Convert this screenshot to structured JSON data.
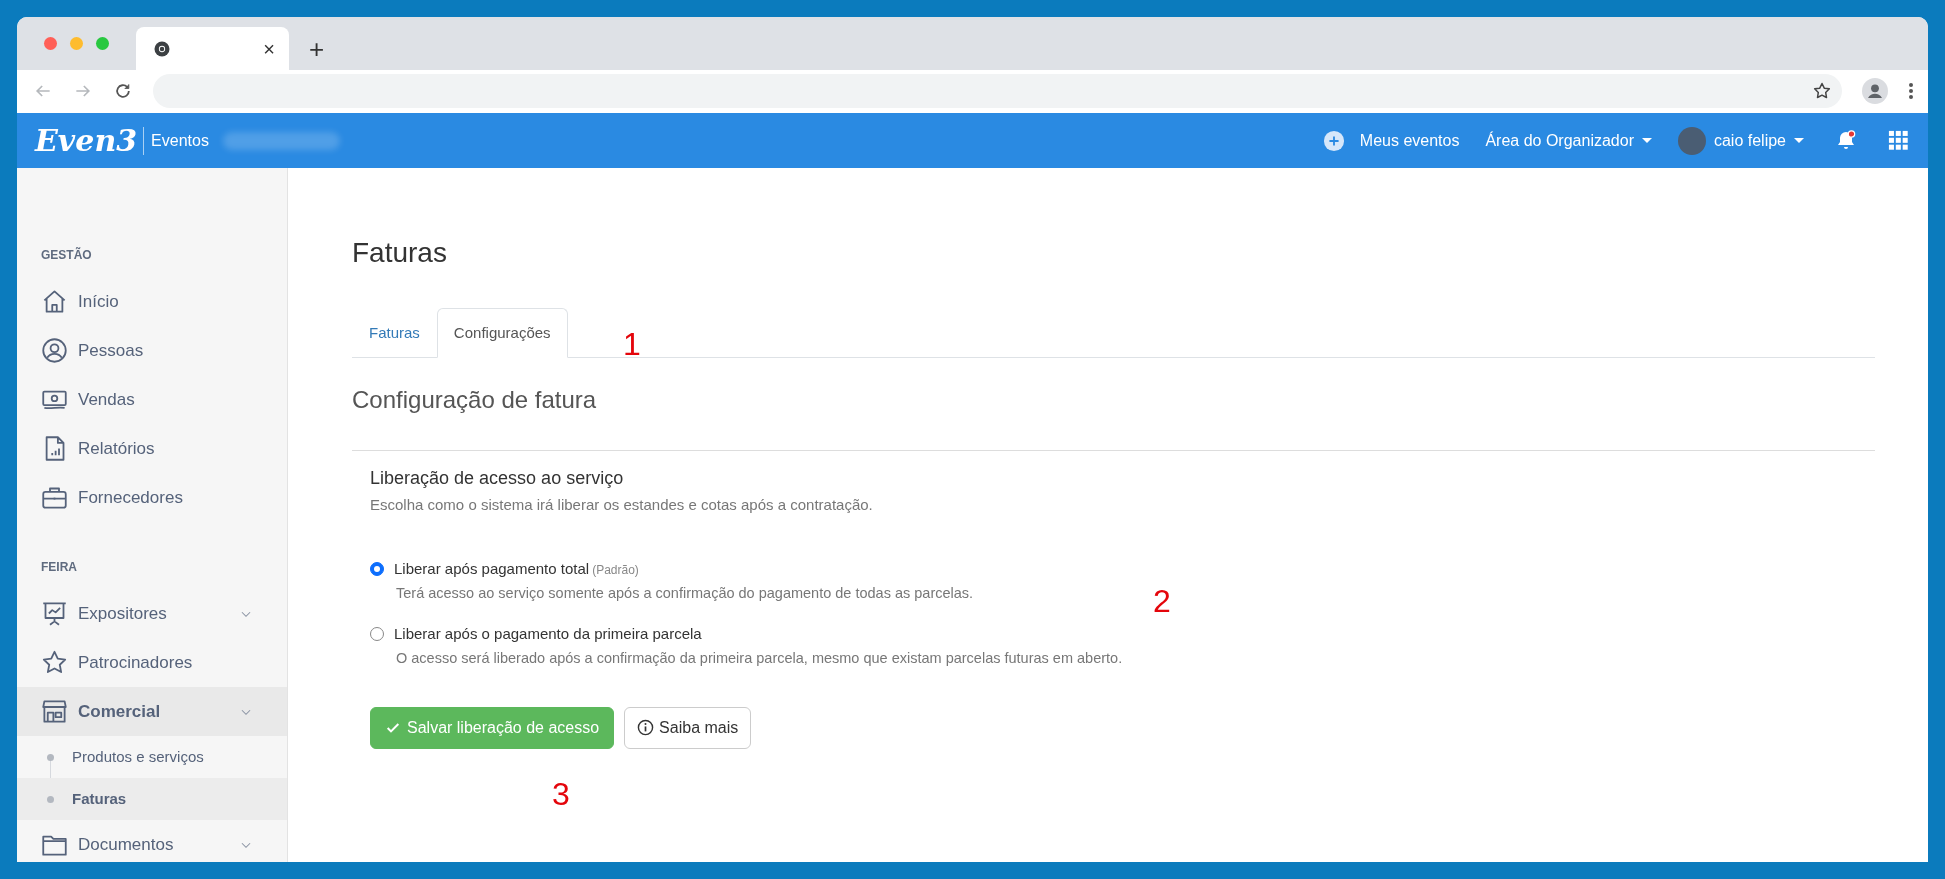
{
  "browser": {
    "tab_close": "×",
    "new_tab": "+"
  },
  "header": {
    "logo": "Even3",
    "app": "Eventos",
    "links": [
      {
        "label": "Meus eventos",
        "kind": "link"
      },
      {
        "label": "Área do Organizador",
        "kind": "dropdown"
      },
      {
        "label": "caio felipe",
        "kind": "user"
      }
    ],
    "notifications": true
  },
  "sidebar": {
    "sections": [
      {
        "title": "GESTÃO",
        "items": [
          {
            "label": "Início",
            "selected": false
          },
          {
            "label": "Pessoas",
            "selected": false
          },
          {
            "label": "Vendas",
            "selected": false
          },
          {
            "label": "Relatórios",
            "selected": false
          },
          {
            "label": "Fornecedores",
            "selected": false
          }
        ]
      },
      {
        "title": "FEIRA",
        "items": [
          {
            "label": "Expositores",
            "selected": false,
            "expanded": false
          },
          {
            "label": "Patrocinadores",
            "selected": false
          },
          {
            "label": "Comercial",
            "selected": true,
            "expanded": true,
            "children": [
              {
                "label": "Produtos e serviços",
                "selected": false
              },
              {
                "label": "Faturas",
                "selected": true
              }
            ]
          },
          {
            "label": "Documentos",
            "selected": false,
            "expanded": false
          }
        ]
      }
    ]
  },
  "main": {
    "title": "Faturas",
    "tabs": [
      {
        "label": "Faturas",
        "selected": false
      },
      {
        "label": "Configurações",
        "selected": true
      }
    ],
    "subtitle": "Configuração de fatura",
    "section": {
      "title": "Liberação de acesso ao serviço",
      "description": "Escolha como o sistema irá liberar os estandes e cotas após a contratação.",
      "options": [
        {
          "label": "Liberar após pagamento total",
          "note": "(Padrão)",
          "description": "Terá acesso ao serviço somente após a confirmação do pagamento de todas as parcelas.",
          "selected": true
        },
        {
          "label": "Liberar após o pagamento da primeira parcela",
          "description": "O acesso será liberado após a confirmação da primeira parcela, mesmo que existam parcelas futuras em aberto.",
          "selected": false
        }
      ]
    },
    "buttons": [
      {
        "label": "Salvar liberação de acesso",
        "kind": "primary"
      },
      {
        "label": "Saiba mais",
        "kind": "info"
      }
    ],
    "annotations": [
      {
        "text": "1"
      },
      {
        "text": "2"
      },
      {
        "text": "3"
      }
    ]
  }
}
